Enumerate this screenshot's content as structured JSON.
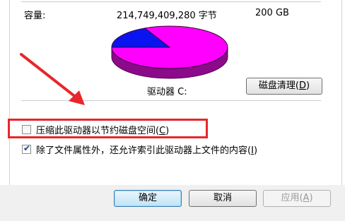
{
  "capacity": {
    "label": "容量:",
    "bytes": "214,749,409,280 字节",
    "size": "200 GB"
  },
  "drive": {
    "label": "驱动器 C:"
  },
  "disk_cleanup_button": {
    "label": "磁盘清理",
    "key": "D"
  },
  "chart_data": {
    "type": "pie",
    "series": [
      {
        "name": "",
        "value": 0.18,
        "color": "#0a14f0"
      },
      {
        "name": "",
        "value": 0.82,
        "color": "#ff00ff"
      }
    ]
  },
  "compress_option": {
    "label": "压缩此驱动器以节约磁盘空间",
    "key": "C",
    "checked": false
  },
  "index_option": {
    "label": "除了文件属性外，还允许索引此驱动器上文件的内容",
    "key": "I",
    "checked": true
  },
  "buttons": {
    "ok": "确定",
    "cancel": "取消",
    "apply": "应用",
    "apply_key": "A"
  }
}
